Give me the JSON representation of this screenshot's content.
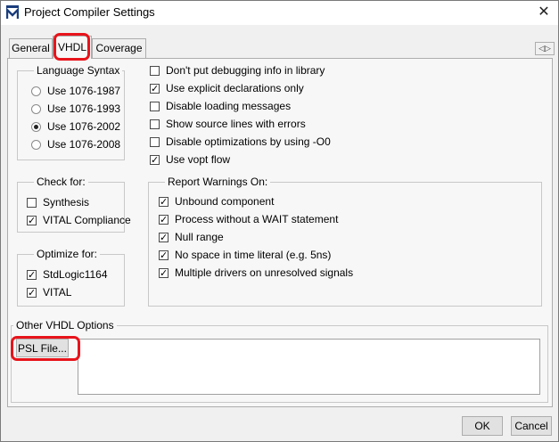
{
  "window": {
    "title": "Project Compiler Settings",
    "close_glyph": "✕"
  },
  "tabs": [
    {
      "label": "General",
      "active": false
    },
    {
      "label": "VHDL",
      "active": true
    },
    {
      "label": "Coverage",
      "active": false
    }
  ],
  "tab_scroll_glyph": "◁▷",
  "language_syntax": {
    "title": "Language Syntax",
    "options": [
      {
        "label": "Use 1076-1987",
        "selected": false
      },
      {
        "label": "Use 1076-1993",
        "selected": false
      },
      {
        "label": "Use 1076-2002",
        "selected": true
      },
      {
        "label": "Use 1076-2008",
        "selected": false
      }
    ]
  },
  "general_checks": [
    {
      "label": "Don't put debugging info in library",
      "checked": false
    },
    {
      "label": "Use explicit declarations only",
      "checked": true
    },
    {
      "label": "Disable loading messages",
      "checked": false
    },
    {
      "label": "Show source lines with errors",
      "checked": false
    },
    {
      "label": "Disable optimizations by using -O0",
      "checked": false
    },
    {
      "label": "Use vopt flow",
      "checked": true
    }
  ],
  "check_for": {
    "title": "Check for:",
    "items": [
      {
        "label": "Synthesis",
        "checked": false
      },
      {
        "label": "VITAL Compliance",
        "checked": true
      }
    ]
  },
  "report_warnings": {
    "title": "Report Warnings On:",
    "items": [
      {
        "label": "Unbound component",
        "checked": true
      },
      {
        "label": "Process without a WAIT statement",
        "checked": true
      },
      {
        "label": "Null range",
        "checked": true
      },
      {
        "label": "No space in time literal (e.g. 5ns)",
        "checked": true
      },
      {
        "label": "Multiple drivers on unresolved signals",
        "checked": true
      }
    ]
  },
  "optimize_for": {
    "title": "Optimize for:",
    "items": [
      {
        "label": "StdLogic1164",
        "checked": true
      },
      {
        "label": "VITAL",
        "checked": true
      }
    ]
  },
  "other_options": {
    "title": "Other VHDL Options",
    "psl_button": "PSL File...",
    "text_value": ""
  },
  "footer": {
    "ok_label": "OK",
    "cancel_label": "Cancel"
  },
  "colors": {
    "highlight": "#e8141b",
    "dialog_bg": "#f0f0f0",
    "panel_bg": "#f7f7f7"
  }
}
